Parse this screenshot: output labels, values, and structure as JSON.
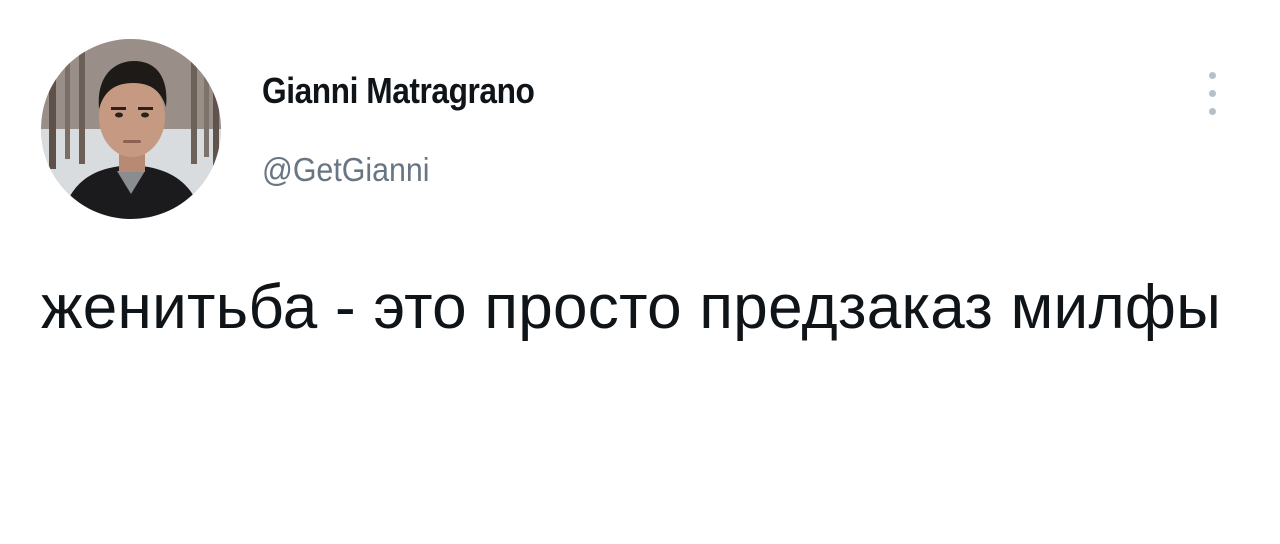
{
  "author": {
    "display_name": "Gianni Matragrano",
    "handle": "@GetGianni",
    "avatar_icon": "profile-photo"
  },
  "menu": {
    "icon": "more-vertical-icon"
  },
  "tweet": {
    "text": "женитьба - это просто предзаказ милфы"
  },
  "colors": {
    "text_primary": "#0f1419",
    "text_secondary": "#687684",
    "menu_dots": "#b6c0c9",
    "background": "#ffffff"
  }
}
